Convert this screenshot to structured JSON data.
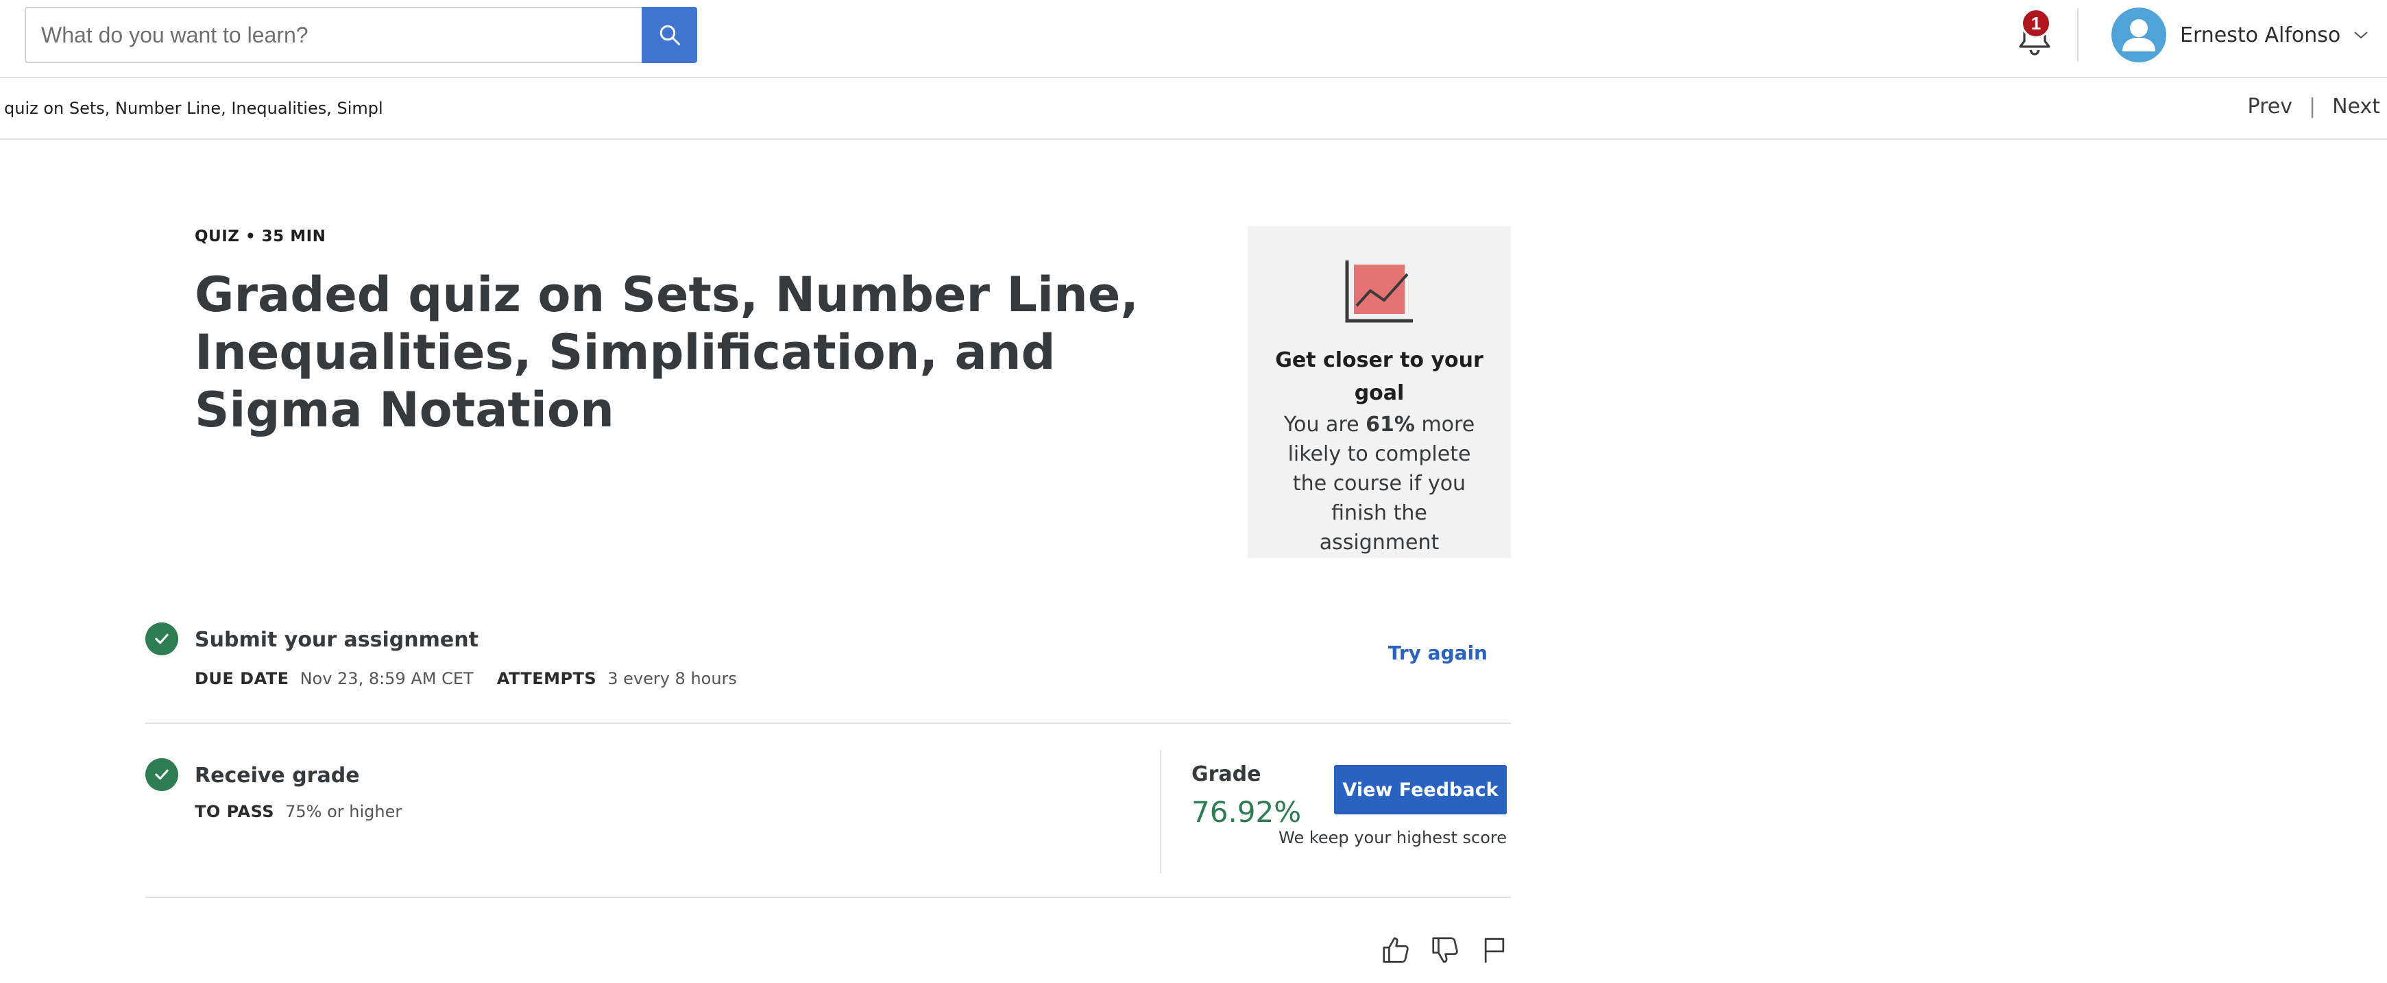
{
  "header": {
    "search": {
      "placeholder": "What do you want to learn?",
      "value": ""
    },
    "notifications": {
      "count": "1"
    },
    "user": {
      "name": "Ernesto Alfonso"
    }
  },
  "subnav": {
    "breadcrumb": "quiz on Sets, Number Line, Inequalities, Simpl",
    "prev_label": "Prev",
    "separator": "|",
    "next_label": "Next"
  },
  "assignment": {
    "kicker": "QUIZ • 35 MIN",
    "title": "Graded quiz on Sets, Number Line, Inequalities, Simplification, and Sigma Notation"
  },
  "goal_card": {
    "heading": "Get closer to your goal",
    "text_before": "You are ",
    "percent": "61%",
    "text_after": " more likely to complete the course if you finish the assignment"
  },
  "submit_step": {
    "title": "Submit your assignment",
    "due_label": "DUE DATE",
    "due_value": "Nov 23, 8:59 AM CET",
    "attempts_label": "ATTEMPTS",
    "attempts_value": "3 every 8 hours",
    "action_label": "Try again"
  },
  "grade_step": {
    "title": "Receive grade",
    "pass_label": "TO PASS",
    "pass_value": "75% or higher",
    "grade_label": "Grade",
    "grade_value": "76.92%",
    "feedback_button": "View Feedback",
    "note": "We keep your highest score"
  },
  "colors": {
    "primary_blue": "#2a62c2",
    "search_blue": "#3f74cf",
    "success_green": "#2d7c52",
    "badge_red": "#b0161f",
    "avatar_blue": "#4fa3d9",
    "goal_icon_red": "#e57373",
    "card_bg": "#f2f2f2"
  },
  "icons": [
    "search-icon",
    "bell-icon",
    "user-icon",
    "chevron-down-icon",
    "chart-icon",
    "check-icon",
    "thumbs-up-icon",
    "thumbs-down-icon",
    "flag-icon"
  ]
}
